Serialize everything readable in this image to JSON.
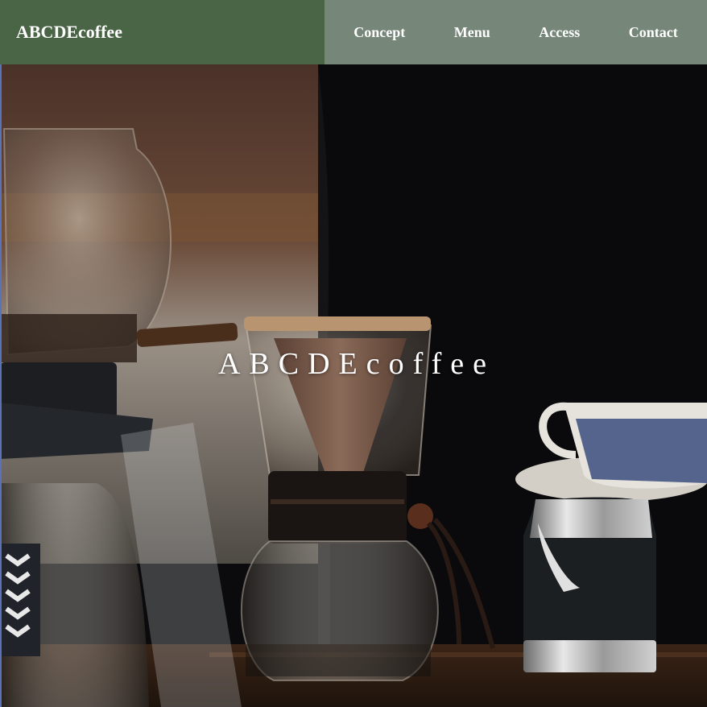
{
  "header": {
    "brand": "ABCDEcoffee",
    "nav": [
      {
        "label": "Concept"
      },
      {
        "label": "Menu"
      },
      {
        "label": "Access"
      },
      {
        "label": "Contact"
      }
    ]
  },
  "hero": {
    "title": "ABCDEcoffee",
    "image_subject": "pour-over coffee dripper with siphon and milk pitcher on wooden counter"
  },
  "colors": {
    "brand_bg": "#4a6446",
    "nav_bg": "#76877a",
    "text": "#ffffff"
  }
}
